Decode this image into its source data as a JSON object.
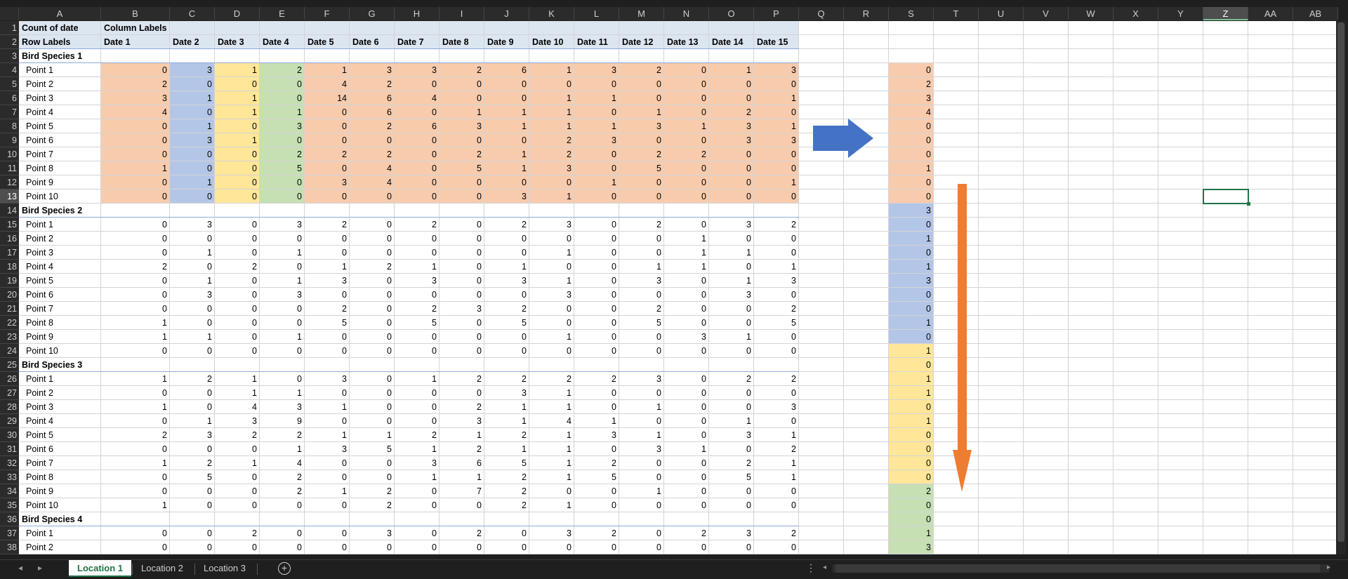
{
  "window": {
    "title": ""
  },
  "columns": [
    "A",
    "B",
    "C",
    "D",
    "E",
    "F",
    "G",
    "H",
    "I",
    "J",
    "K",
    "L",
    "M",
    "N",
    "O",
    "P",
    "Q",
    "R",
    "S",
    "T",
    "U",
    "V",
    "W",
    "X",
    "Y",
    "Z",
    "AA",
    "AB"
  ],
  "selected_column": "Z",
  "selected_row": 13,
  "pivot": {
    "header_row1": {
      "a": "Count of date",
      "b": "Column Labels"
    },
    "header_row2": {
      "a": "Row Labels",
      "dates": [
        "Date 1",
        "Date 2",
        "Date 3",
        "Date 4",
        "Date 5",
        "Date 6",
        "Date 7",
        "Date 8",
        "Date 9",
        "Date 10",
        "Date 11",
        "Date 12",
        "Date 13",
        "Date 14",
        "Date 15"
      ]
    },
    "groups": [
      {
        "label": "Bird Species 1",
        "rows": [
          {
            "point": "Point 1",
            "values": [
              0,
              3,
              1,
              2,
              1,
              3,
              3,
              2,
              6,
              1,
              3,
              2,
              0,
              1,
              3
            ]
          },
          {
            "point": "Point 2",
            "values": [
              2,
              0,
              0,
              0,
              4,
              2,
              0,
              0,
              0,
              0,
              0,
              0,
              0,
              0,
              0
            ]
          },
          {
            "point": "Point 3",
            "values": [
              3,
              1,
              1,
              0,
              14,
              6,
              4,
              0,
              0,
              1,
              1,
              0,
              0,
              0,
              1
            ]
          },
          {
            "point": "Point 4",
            "values": [
              4,
              0,
              1,
              1,
              0,
              6,
              0,
              1,
              1,
              1,
              0,
              1,
              0,
              2,
              0
            ]
          },
          {
            "point": "Point 5",
            "values": [
              0,
              1,
              0,
              3,
              0,
              2,
              6,
              3,
              1,
              1,
              1,
              3,
              1,
              3,
              1
            ]
          },
          {
            "point": "Point 6",
            "values": [
              0,
              3,
              1,
              0,
              0,
              0,
              0,
              0,
              0,
              2,
              3,
              0,
              0,
              3,
              3
            ]
          },
          {
            "point": "Point 7",
            "values": [
              0,
              0,
              0,
              2,
              2,
              2,
              0,
              2,
              1,
              2,
              0,
              2,
              2,
              0,
              0
            ]
          },
          {
            "point": "Point 8",
            "values": [
              1,
              0,
              0,
              5,
              0,
              4,
              0,
              5,
              1,
              3,
              0,
              5,
              0,
              0,
              0
            ]
          },
          {
            "point": "Point 9",
            "values": [
              0,
              1,
              0,
              0,
              3,
              4,
              0,
              0,
              0,
              0,
              1,
              0,
              0,
              0,
              1
            ]
          },
          {
            "point": "Point 10",
            "values": [
              0,
              0,
              0,
              0,
              0,
              0,
              0,
              0,
              3,
              1,
              0,
              0,
              0,
              0,
              0
            ]
          }
        ]
      },
      {
        "label": "Bird Species 2",
        "rows": [
          {
            "point": "Point 1",
            "values": [
              0,
              3,
              0,
              3,
              2,
              0,
              2,
              0,
              2,
              3,
              0,
              2,
              0,
              3,
              2
            ]
          },
          {
            "point": "Point 2",
            "values": [
              0,
              0,
              0,
              0,
              0,
              0,
              0,
              0,
              0,
              0,
              0,
              0,
              1,
              0,
              0
            ]
          },
          {
            "point": "Point 3",
            "values": [
              0,
              1,
              0,
              1,
              0,
              0,
              0,
              0,
              0,
              1,
              0,
              0,
              1,
              1,
              0
            ]
          },
          {
            "point": "Point 4",
            "values": [
              2,
              0,
              2,
              0,
              1,
              2,
              1,
              0,
              1,
              0,
              0,
              1,
              1,
              0,
              1
            ]
          },
          {
            "point": "Point 5",
            "values": [
              0,
              1,
              0,
              1,
              3,
              0,
              3,
              0,
              3,
              1,
              0,
              3,
              0,
              1,
              3
            ]
          },
          {
            "point": "Point 6",
            "values": [
              0,
              3,
              0,
              3,
              0,
              0,
              0,
              0,
              0,
              3,
              0,
              0,
              0,
              3,
              0
            ]
          },
          {
            "point": "Point 7",
            "values": [
              0,
              0,
              0,
              0,
              2,
              0,
              2,
              3,
              2,
              0,
              0,
              2,
              0,
              0,
              2
            ]
          },
          {
            "point": "Point 8",
            "values": [
              1,
              0,
              0,
              0,
              5,
              0,
              5,
              0,
              5,
              0,
              0,
              5,
              0,
              0,
              5
            ]
          },
          {
            "point": "Point 9",
            "values": [
              1,
              1,
              0,
              1,
              0,
              0,
              0,
              0,
              0,
              1,
              0,
              0,
              3,
              1,
              0
            ]
          },
          {
            "point": "Point 10",
            "values": [
              0,
              0,
              0,
              0,
              0,
              0,
              0,
              0,
              0,
              0,
              0,
              0,
              0,
              0,
              0
            ]
          }
        ]
      },
      {
        "label": "Bird Species 3",
        "rows": [
          {
            "point": "Point 1",
            "values": [
              1,
              2,
              1,
              0,
              3,
              0,
              1,
              2,
              2,
              2,
              2,
              3,
              0,
              2,
              2
            ]
          },
          {
            "point": "Point 2",
            "values": [
              0,
              0,
              1,
              1,
              0,
              0,
              0,
              0,
              3,
              1,
              0,
              0,
              0,
              0,
              0
            ]
          },
          {
            "point": "Point 3",
            "values": [
              1,
              0,
              4,
              3,
              1,
              0,
              0,
              2,
              1,
              1,
              0,
              1,
              0,
              0,
              3
            ]
          },
          {
            "point": "Point 4",
            "values": [
              0,
              1,
              3,
              9,
              0,
              0,
              0,
              3,
              1,
              4,
              1,
              0,
              0,
              1,
              0
            ]
          },
          {
            "point": "Point 5",
            "values": [
              2,
              3,
              2,
              2,
              1,
              1,
              2,
              1,
              2,
              1,
              3,
              1,
              0,
              3,
              1
            ]
          },
          {
            "point": "Point 6",
            "values": [
              0,
              0,
              0,
              1,
              3,
              5,
              1,
              2,
              1,
              1,
              0,
              3,
              1,
              0,
              2
            ]
          },
          {
            "point": "Point 7",
            "values": [
              1,
              2,
              1,
              4,
              0,
              0,
              3,
              6,
              5,
              1,
              2,
              0,
              0,
              2,
              1
            ]
          },
          {
            "point": "Point 8",
            "values": [
              0,
              5,
              0,
              2,
              0,
              0,
              1,
              1,
              2,
              1,
              5,
              0,
              0,
              5,
              1
            ]
          },
          {
            "point": "Point 9",
            "values": [
              0,
              0,
              0,
              2,
              1,
              2,
              0,
              7,
              2,
              0,
              0,
              1,
              0,
              0,
              0
            ]
          },
          {
            "point": "Point 10",
            "values": [
              1,
              0,
              0,
              0,
              0,
              2,
              0,
              0,
              2,
              1,
              0,
              0,
              0,
              0,
              0
            ]
          }
        ]
      },
      {
        "label": "Bird Species 4",
        "rows": [
          {
            "point": "Point 1",
            "values": [
              0,
              0,
              2,
              0,
              0,
              3,
              0,
              2,
              0,
              3,
              2,
              0,
              2,
              3,
              2
            ]
          },
          {
            "point": "Point 2",
            "values": [
              0,
              0,
              0,
              0,
              0,
              0,
              0,
              0,
              0,
              0,
              0,
              0,
              0,
              0,
              0
            ]
          }
        ]
      }
    ]
  },
  "column_s_values": [
    0,
    2,
    3,
    4,
    0,
    0,
    0,
    1,
    0,
    0,
    3,
    0,
    1,
    0,
    1,
    3,
    0,
    0,
    1,
    0,
    1,
    0,
    1,
    1,
    0,
    1,
    0,
    0,
    0,
    0,
    2,
    0,
    0,
    1,
    3
  ],
  "colors": {
    "orange": "#f8cbad",
    "blue": "#b4c6e7",
    "yellow": "#ffe699",
    "green": "#c6e0b4",
    "header": "#dce6f1",
    "arrow_blue": "#4472c4",
    "arrow_orange": "#ed7d31",
    "accent_green": "#217346"
  },
  "tabs": {
    "active": "Location 1",
    "items": [
      "Location 1",
      "Location 2",
      "Location 3"
    ]
  },
  "icons": {
    "prev": "chevron-left-icon",
    "next": "chevron-right-icon",
    "add": "add-sheet-icon",
    "more": "more-options-icon"
  }
}
